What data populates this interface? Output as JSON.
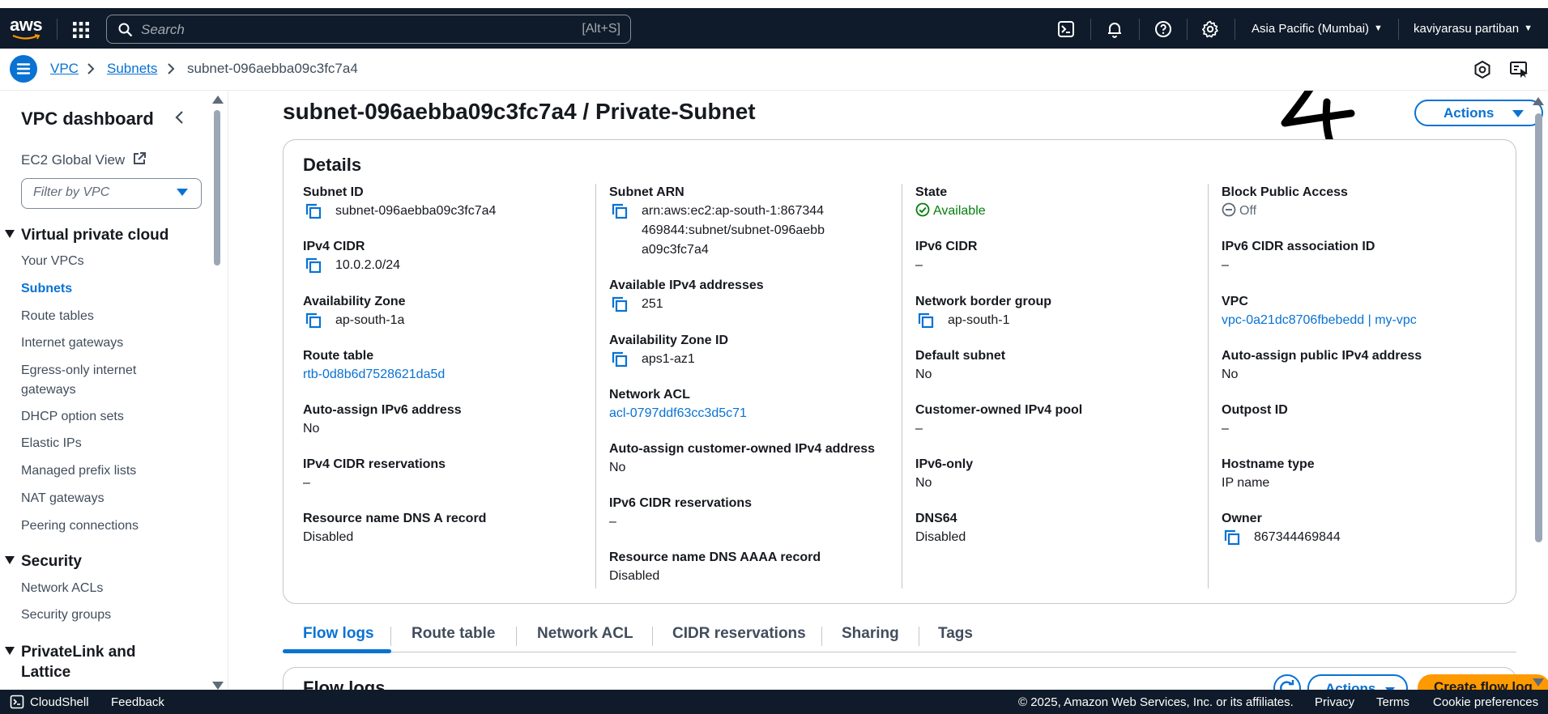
{
  "topnav": {
    "logo": "aws",
    "search_placeholder": "Search",
    "search_shortcut": "[Alt+S]",
    "region": "Asia Pacific (Mumbai)",
    "user": "kaviyarasu partiban"
  },
  "breadcrumb": {
    "items": [
      "VPC",
      "Subnets",
      "subnet-096aebba09c3fc7a4"
    ]
  },
  "sidebar": {
    "title": "VPC dashboard",
    "ec2_global_view": "EC2 Global View",
    "filter_placeholder": "Filter by VPC",
    "sections": [
      {
        "label": "Virtual private cloud",
        "items": [
          {
            "label": "Your VPCs",
            "active": false
          },
          {
            "label": "Subnets",
            "active": true
          },
          {
            "label": "Route tables",
            "active": false
          },
          {
            "label": "Internet gateways",
            "active": false
          },
          {
            "label": "Egress-only internet gateways",
            "active": false
          },
          {
            "label": "DHCP option sets",
            "active": false
          },
          {
            "label": "Elastic IPs",
            "active": false
          },
          {
            "label": "Managed prefix lists",
            "active": false
          },
          {
            "label": "NAT gateways",
            "active": false
          },
          {
            "label": "Peering connections",
            "active": false
          }
        ]
      },
      {
        "label": "Security",
        "items": [
          {
            "label": "Network ACLs",
            "active": false
          },
          {
            "label": "Security groups",
            "active": false
          }
        ]
      },
      {
        "label": "PrivateLink and Lattice",
        "items": []
      }
    ]
  },
  "page": {
    "title": "subnet-096aebba09c3fc7a4 / Private-Subnet",
    "actions_label": "Actions",
    "annotation": "4"
  },
  "details": {
    "heading": "Details",
    "columns": [
      [
        {
          "label": "Subnet ID",
          "value": "subnet-096aebba09c3fc7a4",
          "copy": true
        },
        {
          "label": "IPv4 CIDR",
          "value": "10.0.2.0/24",
          "copy": true
        },
        {
          "label": "Availability Zone",
          "value": "ap-south-1a",
          "copy": true
        },
        {
          "label": "Route table",
          "value": "rtb-0d8b6d7528621da5d",
          "link": true
        },
        {
          "label": "Auto-assign IPv6 address",
          "value": "No"
        },
        {
          "label": "IPv4 CIDR reservations",
          "value": "–"
        },
        {
          "label": "Resource name DNS A record",
          "value": "Disabled"
        }
      ],
      [
        {
          "label": "Subnet ARN",
          "value": "arn:aws:ec2:ap-south-1:867344469844:subnet/subnet-096aebba09c3fc7a4",
          "copy": true
        },
        {
          "label": "Available IPv4 addresses",
          "value": "251",
          "copy": true
        },
        {
          "label": "Availability Zone ID",
          "value": "aps1-az1",
          "copy": true
        },
        {
          "label": "Network ACL",
          "value": "acl-0797ddf63cc3d5c71",
          "link": true
        },
        {
          "label": "Auto-assign customer-owned IPv4 address",
          "value": "No"
        },
        {
          "label": "IPv6 CIDR reservations",
          "value": "–"
        },
        {
          "label": "Resource name DNS AAAA record",
          "value": "Disabled"
        }
      ],
      [
        {
          "label": "State",
          "value": "Available",
          "status": "success"
        },
        {
          "label": "IPv6 CIDR",
          "value": "–"
        },
        {
          "label": "Network border group",
          "value": "ap-south-1",
          "copy": true
        },
        {
          "label": "Default subnet",
          "value": "No"
        },
        {
          "label": "Customer-owned IPv4 pool",
          "value": "–"
        },
        {
          "label": "IPv6-only",
          "value": "No"
        },
        {
          "label": "DNS64",
          "value": "Disabled"
        }
      ],
      [
        {
          "label": "Block Public Access",
          "value": "Off",
          "status": "off"
        },
        {
          "label": "IPv6 CIDR association ID",
          "value": "–"
        },
        {
          "label": "VPC",
          "value": "vpc-0a21dc8706fbebedd | my-vpc",
          "link": true
        },
        {
          "label": "Auto-assign public IPv4 address",
          "value": "No"
        },
        {
          "label": "Outpost ID",
          "value": "–"
        },
        {
          "label": "Hostname type",
          "value": "IP name"
        },
        {
          "label": "Owner",
          "value": "867344469844",
          "copy": true
        }
      ]
    ]
  },
  "tabs": [
    {
      "label": "Flow logs",
      "active": true
    },
    {
      "label": "Route table",
      "active": false
    },
    {
      "label": "Network ACL",
      "active": false
    },
    {
      "label": "CIDR reservations",
      "active": false
    },
    {
      "label": "Sharing",
      "active": false
    },
    {
      "label": "Tags",
      "active": false
    }
  ],
  "flow_logs": {
    "title": "Flow logs",
    "actions_label": "Actions",
    "create_label": "Create flow log"
  },
  "footer": {
    "cloudshell": "CloudShell",
    "feedback": "Feedback",
    "copyright": "© 2025, Amazon Web Services, Inc. or its affiliates.",
    "privacy": "Privacy",
    "terms": "Terms",
    "cookie": "Cookie preferences"
  },
  "colors": {
    "nav_bg": "#0f1b2a",
    "link": "#0972d3",
    "success": "#037f0c",
    "primary_button": "#ff9900"
  }
}
